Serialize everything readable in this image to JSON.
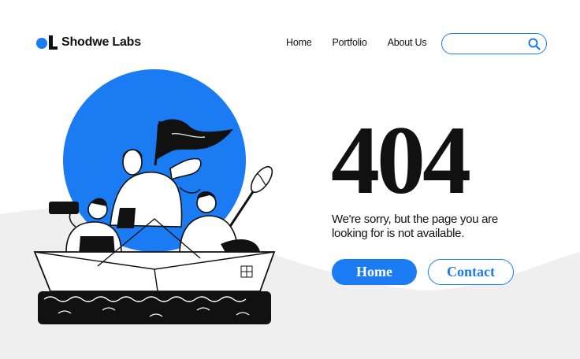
{
  "brand": {
    "name": "Shodwe Labs",
    "accent": "#1b7bf2"
  },
  "nav": {
    "items": [
      {
        "label": "Home"
      },
      {
        "label": "Portfolio"
      },
      {
        "label": "About Us"
      }
    ]
  },
  "search": {
    "value": "",
    "icon": "search-icon"
  },
  "error": {
    "code": "404",
    "message": "We're sorry, but the page you are looking for is not available."
  },
  "actions": {
    "home_label": "Home",
    "contact_label": "Contact"
  }
}
